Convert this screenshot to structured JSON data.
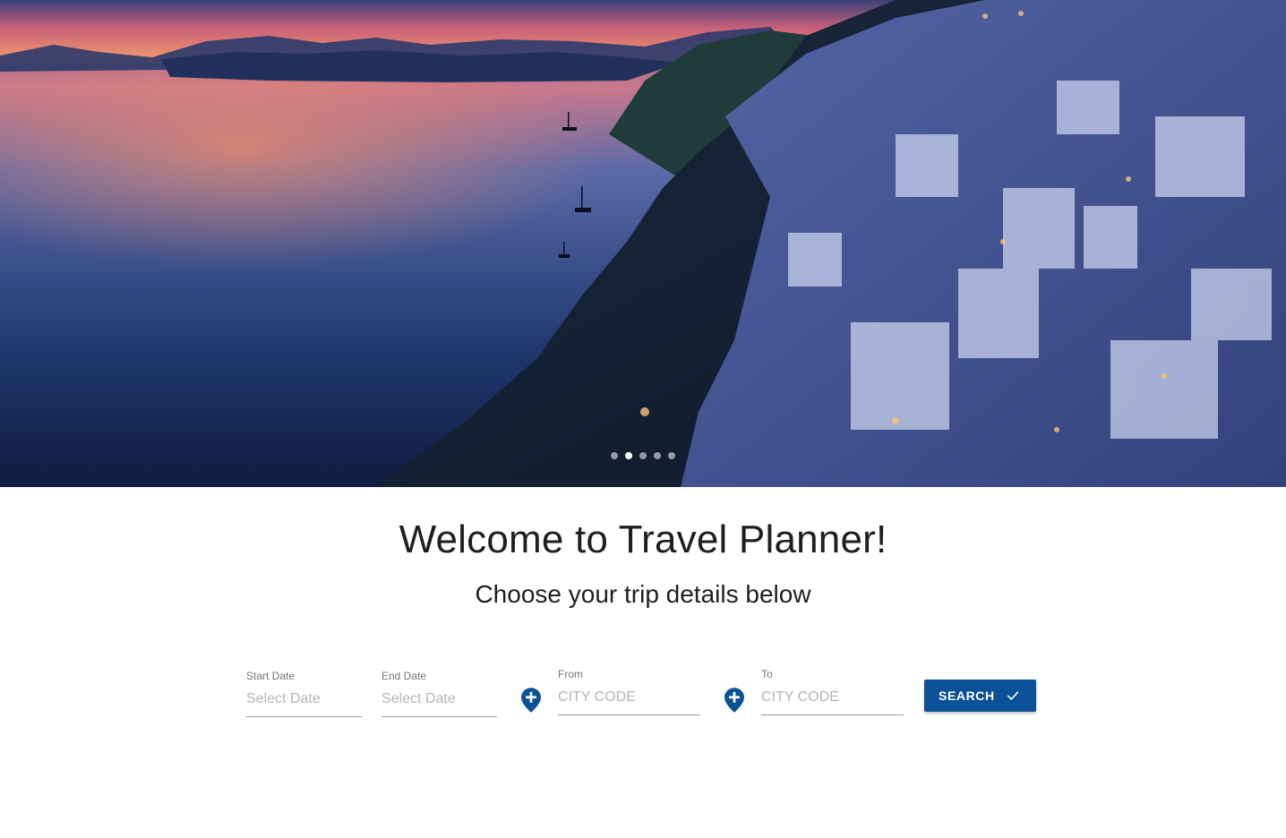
{
  "carousel": {
    "slide_count": 5,
    "active_index": 1
  },
  "welcome": {
    "title": "Welcome to Travel Planner!",
    "subtitle": "Choose your trip details below"
  },
  "form": {
    "start_date": {
      "label": "Start Date",
      "placeholder": "Select Date"
    },
    "end_date": {
      "label": "End Date",
      "placeholder": "Select Date"
    },
    "from": {
      "label": "From",
      "placeholder": "CITY CODE",
      "icon": "add-location-icon"
    },
    "to": {
      "label": "To",
      "placeholder": "CITY CODE",
      "icon": "add-location-icon"
    },
    "search_label": "SEARCH",
    "search_icon": "check-icon"
  },
  "colors": {
    "accent": "#0b5197",
    "pin": "#0b5197"
  }
}
